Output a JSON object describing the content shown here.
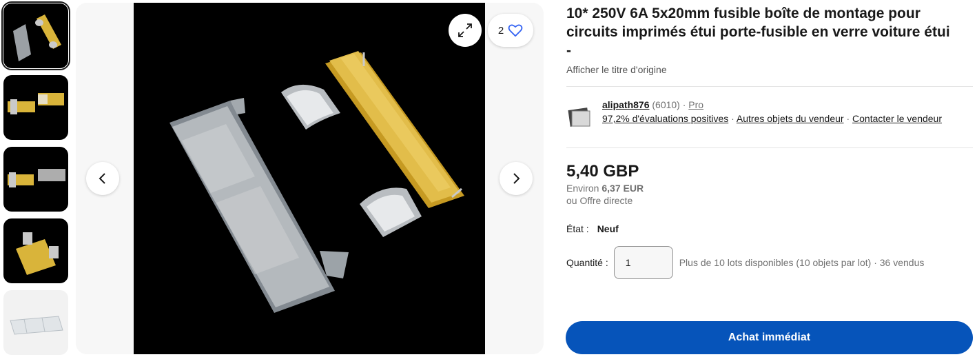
{
  "gallery": {
    "thumbnails": [
      {
        "name": "thumbnail-1",
        "active": true
      },
      {
        "name": "thumbnail-2",
        "active": false
      },
      {
        "name": "thumbnail-3",
        "active": false
      },
      {
        "name": "thumbnail-4",
        "active": false
      },
      {
        "name": "thumbnail-5",
        "active": false
      }
    ],
    "watch_count": "2",
    "icons": {
      "prev": "chevron-left-icon",
      "next": "chevron-right-icon",
      "expand": "expand-icon",
      "watch": "heart-icon"
    }
  },
  "listing": {
    "title": "10* 250V 6A 5x20mm fusible boîte de montage pour circuits imprimés étui porte-fusible en verre voiture étui",
    "subtitle": "-",
    "original_title_link": "Afficher le titre d'origine"
  },
  "seller": {
    "name": "alipath876",
    "feedback_count": "(6010)",
    "separator": "·",
    "badge": "Pro",
    "positive_feedback": "97,2% d'évaluations positives",
    "other_items": "Autres objets du vendeur",
    "contact": "Contacter le vendeur"
  },
  "pricing": {
    "price": "5,40 GBP",
    "approx_prefix": "Environ",
    "approx_value": "6,37 EUR",
    "best_offer": "ou Offre directe"
  },
  "condition": {
    "label": "État :",
    "value": "Neuf"
  },
  "quantity": {
    "label": "Quantité :",
    "value": "1",
    "availability": "Plus de 10 lots disponibles (10 objets par lot)",
    "sold": "36 vendus"
  },
  "actions": {
    "buy_now": "Achat immédiat"
  },
  "colors": {
    "buy_button": "#0654ba",
    "fuse_holder_yellow": "#d9b43a",
    "photo_background": "#000000"
  }
}
